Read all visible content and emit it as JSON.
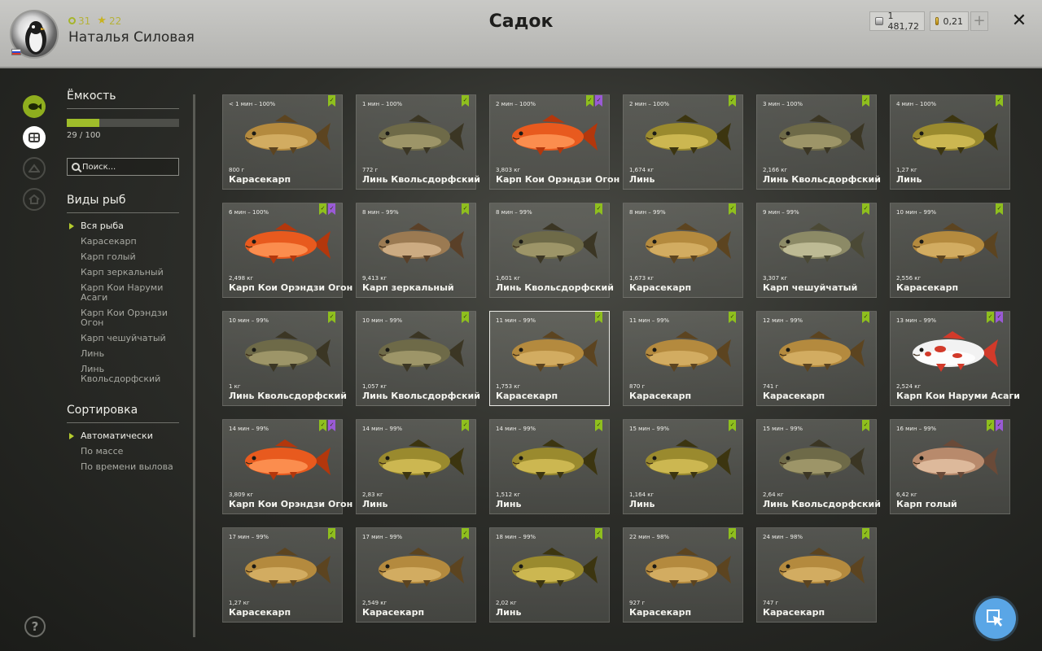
{
  "header": {
    "level": "31",
    "rank": "22",
    "username": "Наталья Силовая",
    "title": "Садок",
    "silver": "1 481,72",
    "gold": "0,21",
    "plus_label": "+",
    "close_label": "✕"
  },
  "capacity": {
    "title": "Ёмкость",
    "text": "29 / 100",
    "fill_fraction": 0.29
  },
  "search": {
    "placeholder": "Поиск..."
  },
  "species": {
    "title": "Виды рыб",
    "items": [
      "Вся рыба",
      "Карасекарп",
      "Карп голый",
      "Карп зеркальный",
      "Карп Кои Наруми Асаги",
      "Карп Кои Орэндзи Огон",
      "Карп чешуйчатый",
      "Линь",
      "Линь Квольсдорфский"
    ],
    "active_index": 0
  },
  "sorting": {
    "title": "Сортировка",
    "items": [
      "Автоматически",
      "По массе",
      "По времени вылова"
    ],
    "active_index": 0
  },
  "help_label": "?",
  "colors": {
    "accent_green": "#8fbf1e",
    "badge_purple": "#9a5ad6",
    "cursor_blue": "#5aa6e6"
  },
  "cards": [
    {
      "time": "< 1 мин – 100%",
      "weight": "800 г",
      "name": "Карасекарп",
      "fish": "karasekarp",
      "badges": [
        "green"
      ]
    },
    {
      "time": "1 мин – 100%",
      "weight": "772 г",
      "name": "Линь Квольсдорфский",
      "fish": "lin-kv",
      "badges": [
        "green"
      ]
    },
    {
      "time": "2 мин – 100%",
      "weight": "3,803 кг",
      "name": "Карп Кои Орэндзи Огон",
      "fish": "koi-orange",
      "badges": [
        "green",
        "purple"
      ]
    },
    {
      "time": "2 мин – 100%",
      "weight": "1,674 кг",
      "name": "Линь",
      "fish": "lin",
      "badges": [
        "green"
      ]
    },
    {
      "time": "3 мин – 100%",
      "weight": "2,166 кг",
      "name": "Линь Квольсдорфский",
      "fish": "lin-kv",
      "badges": [
        "green"
      ]
    },
    {
      "time": "4 мин – 100%",
      "weight": "1,27 кг",
      "name": "Линь",
      "fish": "lin",
      "badges": [
        "green"
      ]
    },
    {
      "time": "6 мин – 100%",
      "weight": "2,498 кг",
      "name": "Карп Кои Орэндзи Огон",
      "fish": "koi-orange",
      "badges": [
        "green",
        "purple"
      ]
    },
    {
      "time": "8 мин – 99%",
      "weight": "9,413 кг",
      "name": "Карп зеркальный",
      "fish": "mirror",
      "badges": [
        "green"
      ]
    },
    {
      "time": "8 мин – 99%",
      "weight": "1,601 кг",
      "name": "Линь Квольсдорфский",
      "fish": "lin-kv",
      "badges": [
        "green"
      ]
    },
    {
      "time": "8 мин – 99%",
      "weight": "1,673 кг",
      "name": "Карасекарп",
      "fish": "karasekarp",
      "badges": [
        "green"
      ]
    },
    {
      "time": "9 мин – 99%",
      "weight": "3,307 кг",
      "name": "Карп чешуйчатый",
      "fish": "scaly",
      "badges": [
        "green"
      ]
    },
    {
      "time": "10 мин – 99%",
      "weight": "2,556 кг",
      "name": "Карасекарп",
      "fish": "karasekarp",
      "badges": [
        "green"
      ]
    },
    {
      "time": "10 мин – 99%",
      "weight": "1 кг",
      "name": "Линь Квольсдорфский",
      "fish": "lin-kv",
      "badges": [
        "green"
      ]
    },
    {
      "time": "10 мин – 99%",
      "weight": "1,057 кг",
      "name": "Линь Квольсдорфский",
      "fish": "lin-kv",
      "badges": [
        "green"
      ]
    },
    {
      "time": "11 мин – 99%",
      "weight": "1,753 кг",
      "name": "Карасекарп",
      "fish": "karasekarp",
      "badges": [
        "green"
      ],
      "selected": true
    },
    {
      "time": "11 мин – 99%",
      "weight": "870 г",
      "name": "Карасекарп",
      "fish": "karasekarp",
      "badges": [
        "green"
      ]
    },
    {
      "time": "12 мин – 99%",
      "weight": "741 г",
      "name": "Карасекарп",
      "fish": "karasekarp",
      "badges": [
        "green"
      ]
    },
    {
      "time": "13 мин – 99%",
      "weight": "2,524 кг",
      "name": "Карп Кои Наруми Асаги",
      "fish": "koi-asagi",
      "badges": [
        "green",
        "purple"
      ]
    },
    {
      "time": "14 мин – 99%",
      "weight": "3,809 кг",
      "name": "Карп Кои Орэндзи Огон",
      "fish": "koi-orange",
      "badges": [
        "green",
        "purple"
      ]
    },
    {
      "time": "14 мин – 99%",
      "weight": "2,83 кг",
      "name": "Линь",
      "fish": "lin",
      "badges": [
        "green"
      ]
    },
    {
      "time": "14 мин – 99%",
      "weight": "1,512 кг",
      "name": "Линь",
      "fish": "lin",
      "badges": [
        "green"
      ]
    },
    {
      "time": "15 мин – 99%",
      "weight": "1,164 кг",
      "name": "Линь",
      "fish": "lin",
      "badges": [
        "green"
      ]
    },
    {
      "time": "15 мин – 99%",
      "weight": "2,64 кг",
      "name": "Линь Квольсдорфский",
      "fish": "lin-kv",
      "badges": [
        "green"
      ]
    },
    {
      "time": "16 мин – 99%",
      "weight": "6,42 кг",
      "name": "Карп голый",
      "fish": "leather",
      "badges": [
        "green",
        "purple"
      ]
    },
    {
      "time": "17 мин – 99%",
      "weight": "1,27 кг",
      "name": "Карасекарп",
      "fish": "karasekarp",
      "badges": [
        "green"
      ]
    },
    {
      "time": "17 мин – 99%",
      "weight": "2,549 кг",
      "name": "Карасекарп",
      "fish": "karasekarp",
      "badges": [
        "green"
      ]
    },
    {
      "time": "18 мин – 99%",
      "weight": "2,02 кг",
      "name": "Линь",
      "fish": "lin",
      "badges": [
        "green"
      ]
    },
    {
      "time": "22 мин – 98%",
      "weight": "927 г",
      "name": "Карасекарп",
      "fish": "karasekarp",
      "badges": [
        "green"
      ]
    },
    {
      "time": "24 мин – 98%",
      "weight": "747 г",
      "name": "Карасекарп",
      "fish": "karasekarp",
      "badges": [
        "green"
      ]
    }
  ]
}
